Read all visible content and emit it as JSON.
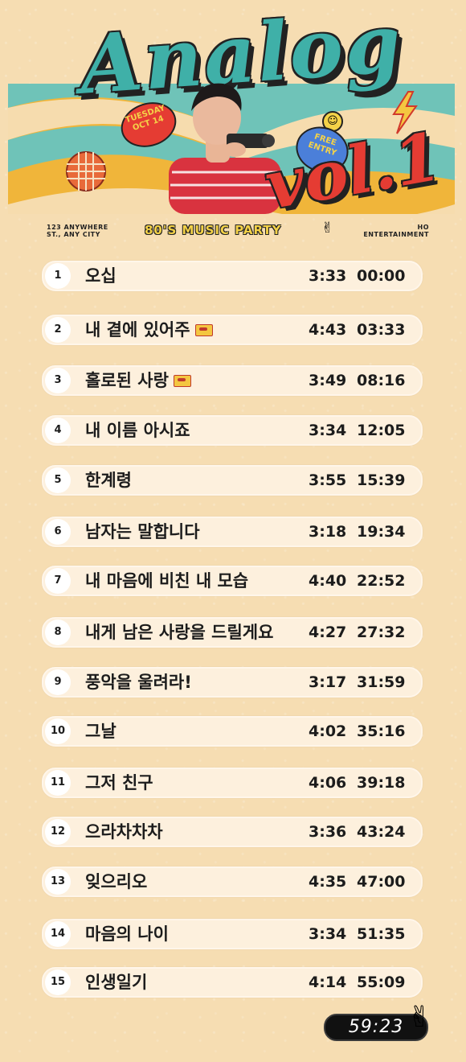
{
  "header": {
    "title": "Analog",
    "volume": "vol.1",
    "date_line1": "TUESDAY",
    "date_line2": "OCT 14",
    "free_line1": "FREE",
    "free_line2": "ENTRY",
    "address_line1": "123 ANYWHERE",
    "address_line2": "ST., ANY CITY",
    "party": "80'S MUSIC PARTY",
    "org_line1": "HO",
    "org_line2": "ENTERTAINMENT",
    "colors": {
      "teal": "#3fb0a8",
      "red": "#e53c33",
      "yellow": "#f4d248",
      "orange": "#f0b53a"
    }
  },
  "tracks": [
    {
      "num": "1",
      "title": "오십",
      "duration": "3:33",
      "start": "00:00",
      "tape": false
    },
    {
      "num": "2",
      "title": "내 곁에 있어주",
      "duration": "4:43",
      "start": "03:33",
      "tape": true
    },
    {
      "num": "3",
      "title": "홀로된 사랑",
      "duration": "3:49",
      "start": "08:16",
      "tape": true
    },
    {
      "num": "4",
      "title": "내 이름 아시죠",
      "duration": "3:34",
      "start": "12:05",
      "tape": false
    },
    {
      "num": "5",
      "title": "한계령",
      "duration": "3:55",
      "start": "15:39",
      "tape": false
    },
    {
      "num": "6",
      "title": "남자는 말합니다",
      "duration": "3:18",
      "start": "19:34",
      "tape": false
    },
    {
      "num": "7",
      "title": "내 마음에 비친 내 모습",
      "duration": "4:40",
      "start": "22:52",
      "tape": false
    },
    {
      "num": "8",
      "title": "내게 남은 사랑을 드릴게요",
      "duration": "4:27",
      "start": "27:32",
      "tape": false
    },
    {
      "num": "9",
      "title": "풍악을 울려라!",
      "duration": "3:17",
      "start": "31:59",
      "tape": false
    },
    {
      "num": "10",
      "title": "그날",
      "duration": "4:02",
      "start": "35:16",
      "tape": false
    },
    {
      "num": "11",
      "title": "그저 친구",
      "duration": "4:06",
      "start": "39:18",
      "tape": false
    },
    {
      "num": "12",
      "title": "으라차차차",
      "duration": "3:36",
      "start": "43:24",
      "tape": false
    },
    {
      "num": "13",
      "title": "잊으리오",
      "duration": "4:35",
      "start": "47:00",
      "tape": false
    },
    {
      "num": "14",
      "title": "마음의 나이",
      "duration": "3:34",
      "start": "51:35",
      "tape": false
    },
    {
      "num": "15",
      "title": "인생일기",
      "duration": "4:14",
      "start": "55:09",
      "tape": false
    }
  ],
  "total": "59:23",
  "icons": {
    "tape": "cassette-tape-icon",
    "peace": "peace-hand-icon",
    "smiley": "smiley-icon",
    "bolt": "lightning-bolt-icon",
    "disco": "disco-ball-icon"
  }
}
